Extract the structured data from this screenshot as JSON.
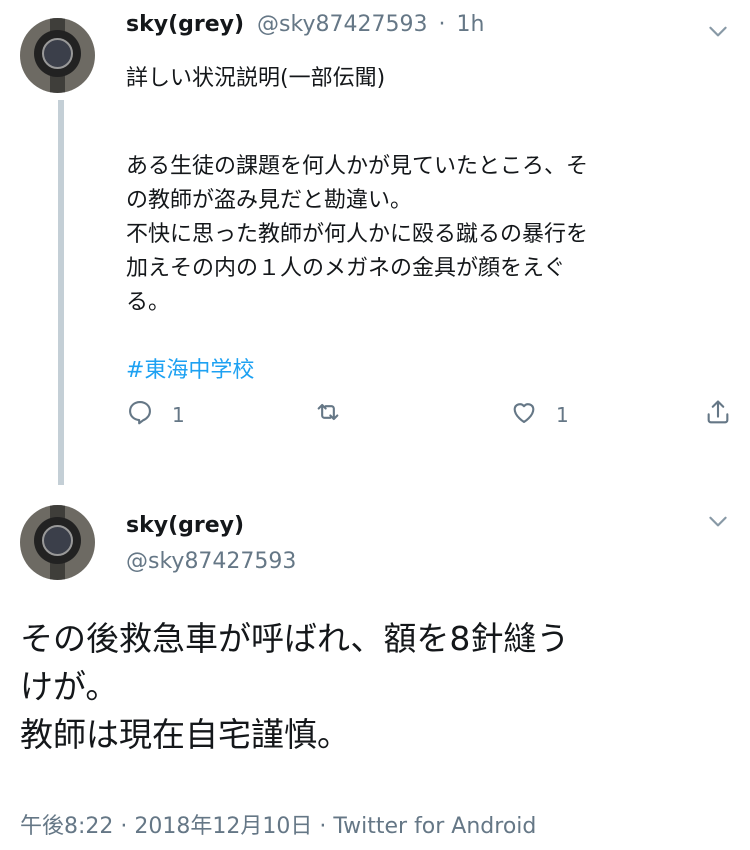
{
  "tweet1": {
    "display_name": "sky(grey)",
    "handle": "@sky87427593",
    "separator": "·",
    "time": "1h",
    "lines": [
      "詳しい状況説明(一部伝聞)",
      "",
      "ある生徒の課題を何人かが見ていたところ、そ",
      "の教師が盗み見だと勘違い。",
      "不快に思った教師が何人かに殴る蹴るの暴行を",
      "加えその内の１人のメガネの金具が顔をえぐ",
      "る。"
    ],
    "hashtag": "#東海中学校",
    "reply_count": "1",
    "like_count": "1"
  },
  "tweet2": {
    "display_name": "sky(grey)",
    "handle": "@sky87427593",
    "lines": [
      "その後救急車が呼ばれ、額を8針縫う",
      "けが。",
      "教師は現在自宅謹慎。"
    ],
    "footer": "午後8:22 · 2018年12月10日 · Twitter for Android"
  },
  "icons": [
    "avatar",
    "chevron-down-icon",
    "reply-icon",
    "retweet-icon",
    "like-icon",
    "share-icon"
  ],
  "colors": {
    "link": "#1da1f2",
    "secondary": "#657786",
    "thread_line": "#c4cfd6"
  }
}
